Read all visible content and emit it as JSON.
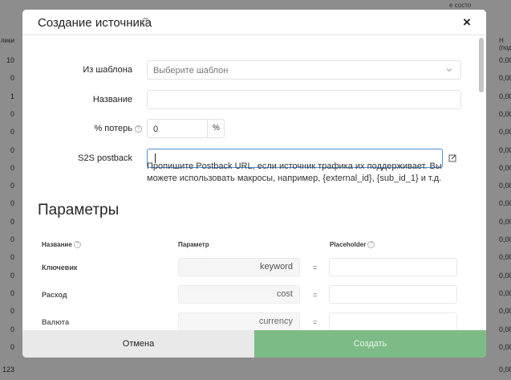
{
  "background": {
    "left_header": "лики",
    "left_values": [
      "10",
      "0",
      "1",
      "0",
      "0",
      "0",
      "0",
      "0",
      "0",
      "0",
      "0",
      "0",
      "0",
      "0",
      "0",
      "0",
      "0",
      "123"
    ],
    "right_header": "Н (подтв",
    "right_values": [
      "0,00",
      "0,00",
      "0,00",
      "0,00",
      "0,00",
      "0,00",
      "0,00",
      "0,00",
      "0,00",
      "0,00",
      "0,00",
      "0,00",
      "0,00",
      "0,00",
      "0,00",
      "0,00",
      "0,00",
      "0,00"
    ],
    "top_right_text": "е состо"
  },
  "modal": {
    "title": "Создание источника",
    "close": "×",
    "form": {
      "template_label": "Из шаблона",
      "template_placeholder": "Выберите шаблон",
      "name_label": "Название",
      "name_value": "",
      "loss_label": "% потерь",
      "loss_value": "0",
      "loss_addon": "%",
      "s2s_label": "S2S postback",
      "s2s_value": "",
      "s2s_hint": "Пропишите Postback URL, если источник трафика их поддерживает. Вы можете использовать макросы, например, {external_id}, {sub_id_1} и т.д."
    },
    "params": {
      "section_title": "Параметры",
      "col_name": "Название",
      "col_param": "Параметр",
      "col_placeholder": "Placeholder",
      "eq": "=",
      "rows": [
        {
          "name": "Ключевик",
          "param": "keyword",
          "placeholder": ""
        },
        {
          "name": "Расход",
          "param": "cost",
          "placeholder": ""
        },
        {
          "name": "Валюта",
          "param": "currency",
          "placeholder": ""
        }
      ]
    },
    "footer": {
      "cancel": "Отмена",
      "create": "Создать"
    }
  }
}
